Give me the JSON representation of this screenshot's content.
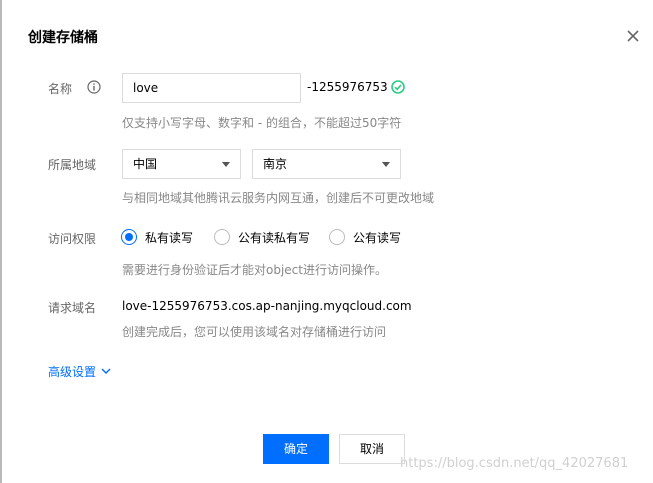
{
  "dialog": {
    "title": "创建存储桶"
  },
  "name_field": {
    "label": "名称",
    "value": "love",
    "suffix": "-1255976753",
    "hint": "仅支持小写字母、数字和 - 的组合，不能超过50字符"
  },
  "region_field": {
    "label": "所属地域",
    "country": "中国",
    "city": "南京",
    "hint": "与相同地域其他腾讯云服务内网互通，创建后不可更改地域"
  },
  "access_field": {
    "label": "访问权限",
    "options": [
      {
        "label": "私有读写",
        "selected": true
      },
      {
        "label": "公有读私有写",
        "selected": false
      },
      {
        "label": "公有读写",
        "selected": false
      }
    ],
    "hint": "需要进行身份验证后才能对object进行访问操作。"
  },
  "domain_field": {
    "label": "请求域名",
    "value": "love-1255976753.cos.ap-nanjing.myqcloud.com",
    "hint": "创建完成后，您可以使用该域名对存储桶进行访问"
  },
  "advanced": {
    "label": "高级设置"
  },
  "footer": {
    "confirm_label": "确定",
    "cancel_label": "取消"
  },
  "watermark": "https://blog.csdn.net/qq_42027681",
  "colors": {
    "accent": "#006eff",
    "success": "#29cc85"
  }
}
